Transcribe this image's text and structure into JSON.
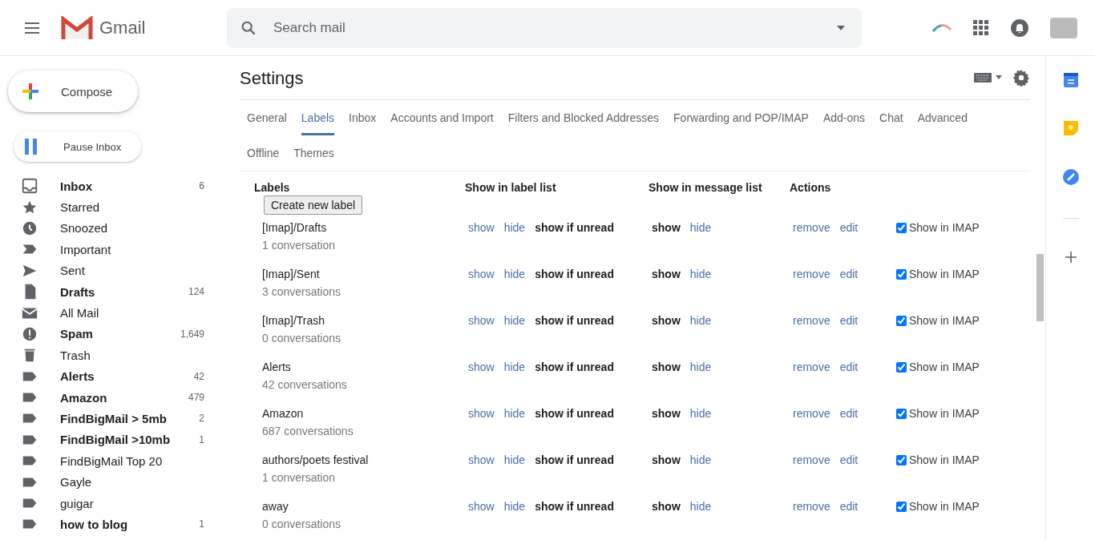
{
  "app": {
    "name": "Gmail"
  },
  "search": {
    "placeholder": "Search mail"
  },
  "compose": {
    "label": "Compose"
  },
  "pause": {
    "label": "Pause Inbox"
  },
  "sidebar": {
    "items": [
      {
        "kind": "inbox",
        "label": "Inbox",
        "count": "6",
        "unread": true
      },
      {
        "kind": "star",
        "label": "Starred",
        "unread": false
      },
      {
        "kind": "clock",
        "label": "Snoozed",
        "unread": false
      },
      {
        "kind": "important",
        "label": "Important",
        "unread": false
      },
      {
        "kind": "send",
        "label": "Sent",
        "unread": false
      },
      {
        "kind": "draft",
        "label": "Drafts",
        "count": "124",
        "unread": true
      },
      {
        "kind": "mail",
        "label": "All Mail",
        "unread": false
      },
      {
        "kind": "spam",
        "label": "Spam",
        "count": "1,649",
        "unread": true
      },
      {
        "kind": "trash",
        "label": "Trash",
        "unread": false
      },
      {
        "kind": "label",
        "label": "Alerts",
        "count": "42",
        "unread": true
      },
      {
        "kind": "label",
        "label": "Amazon",
        "count": "479",
        "unread": true
      },
      {
        "kind": "label",
        "label": "FindBigMail > 5mb",
        "count": "2",
        "unread": true
      },
      {
        "kind": "label",
        "label": "FindBigMail >10mb",
        "count": "1",
        "unread": true
      },
      {
        "kind": "label",
        "label": "FindBigMail Top 20",
        "unread": false
      },
      {
        "kind": "label",
        "label": "Gayle",
        "unread": false
      },
      {
        "kind": "label",
        "label": "guigar",
        "unread": false
      },
      {
        "kind": "label",
        "label": "how to blog",
        "count": "1",
        "unread": true
      }
    ]
  },
  "settings": {
    "title": "Settings",
    "tabs": [
      {
        "label": "General",
        "selected": false
      },
      {
        "label": "Labels",
        "selected": true
      },
      {
        "label": "Inbox",
        "selected": false
      },
      {
        "label": "Accounts and Import",
        "selected": false
      },
      {
        "label": "Filters and Blocked Addresses",
        "selected": false
      },
      {
        "label": "Forwarding and POP/IMAP",
        "selected": false
      },
      {
        "label": "Add-ons",
        "selected": false
      },
      {
        "label": "Chat",
        "selected": false
      },
      {
        "label": "Advanced",
        "selected": false
      },
      {
        "label": "Offline",
        "selected": false
      },
      {
        "label": "Themes",
        "selected": false
      }
    ],
    "table": {
      "columns": [
        "Labels",
        "Show in label list",
        "Show in message list",
        "Actions"
      ],
      "create_button": "Create new label",
      "rows": [
        {
          "name": "[Imap]/Drafts",
          "conversations": "1 conversation",
          "label_list": [
            {
              "label": "show",
              "selected": false
            },
            {
              "label": "hide",
              "selected": false
            },
            {
              "label": "show if unread",
              "selected": true
            }
          ],
          "message_list": [
            {
              "label": "show",
              "selected": true
            },
            {
              "label": "hide",
              "selected": false
            }
          ],
          "actions": [
            "remove",
            "edit"
          ],
          "imap": {
            "label": "Show in IMAP",
            "checked": true
          }
        },
        {
          "name": "[Imap]/Sent",
          "conversations": "3 conversations",
          "label_list": [
            {
              "label": "show",
              "selected": false
            },
            {
              "label": "hide",
              "selected": false
            },
            {
              "label": "show if unread",
              "selected": true
            }
          ],
          "message_list": [
            {
              "label": "show",
              "selected": true
            },
            {
              "label": "hide",
              "selected": false
            }
          ],
          "actions": [
            "remove",
            "edit"
          ],
          "imap": {
            "label": "Show in IMAP",
            "checked": true
          }
        },
        {
          "name": "[Imap]/Trash",
          "conversations": "0 conversations",
          "label_list": [
            {
              "label": "show",
              "selected": false
            },
            {
              "label": "hide",
              "selected": false
            },
            {
              "label": "show if unread",
              "selected": true
            }
          ],
          "message_list": [
            {
              "label": "show",
              "selected": true
            },
            {
              "label": "hide",
              "selected": false
            }
          ],
          "actions": [
            "remove",
            "edit"
          ],
          "imap": {
            "label": "Show in IMAP",
            "checked": true
          }
        },
        {
          "name": "Alerts",
          "conversations": "42 conversations",
          "label_list": [
            {
              "label": "show",
              "selected": false
            },
            {
              "label": "hide",
              "selected": false
            },
            {
              "label": "show if unread",
              "selected": true
            }
          ],
          "message_list": [
            {
              "label": "show",
              "selected": true
            },
            {
              "label": "hide",
              "selected": false
            }
          ],
          "actions": [
            "remove",
            "edit"
          ],
          "imap": {
            "label": "Show in IMAP",
            "checked": true
          }
        },
        {
          "name": "Amazon",
          "conversations": "687 conversations",
          "label_list": [
            {
              "label": "show",
              "selected": false
            },
            {
              "label": "hide",
              "selected": false
            },
            {
              "label": "show if unread",
              "selected": true
            }
          ],
          "message_list": [
            {
              "label": "show",
              "selected": true
            },
            {
              "label": "hide",
              "selected": false
            }
          ],
          "actions": [
            "remove",
            "edit"
          ],
          "imap": {
            "label": "Show in IMAP",
            "checked": true
          }
        },
        {
          "name": "authors/poets festival",
          "conversations": "1 conversation",
          "label_list": [
            {
              "label": "show",
              "selected": false
            },
            {
              "label": "hide",
              "selected": false
            },
            {
              "label": "show if unread",
              "selected": true
            }
          ],
          "message_list": [
            {
              "label": "show",
              "selected": true
            },
            {
              "label": "hide",
              "selected": false
            }
          ],
          "actions": [
            "remove",
            "edit"
          ],
          "imap": {
            "label": "Show in IMAP",
            "checked": true
          }
        },
        {
          "name": "away",
          "conversations": "0 conversations",
          "label_list": [
            {
              "label": "show",
              "selected": false
            },
            {
              "label": "hide",
              "selected": false
            },
            {
              "label": "show if unread",
              "selected": true
            }
          ],
          "message_list": [
            {
              "label": "show",
              "selected": true
            },
            {
              "label": "hide",
              "selected": false
            }
          ],
          "actions": [
            "remove",
            "edit"
          ],
          "imap": {
            "label": "Show in IMAP",
            "checked": true
          }
        }
      ]
    }
  }
}
